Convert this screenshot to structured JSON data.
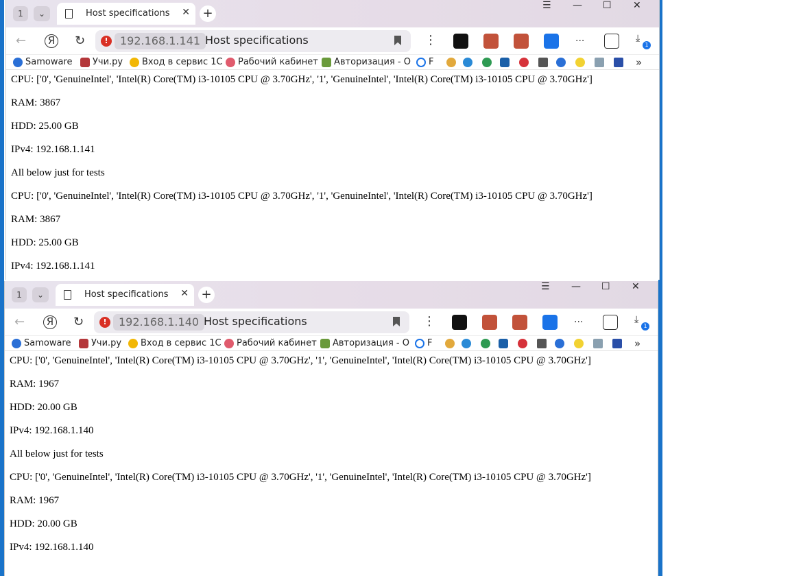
{
  "windows": [
    {
      "tab_count": "1",
      "tab_title": "Host specifications",
      "address_ip": "192.168.1.141",
      "address_title": "Host specifications",
      "ext_more": "...",
      "download_badge": "1",
      "bookmarks": [
        "Samoware",
        "Учи.ру",
        "Вход в сервис 1С",
        "Рабочий кабинет",
        "Авторизация - О",
        "F"
      ],
      "lines": [
        "CPU: ['0', 'GenuineIntel', 'Intel(R) Core(TM) i3-10105 CPU @ 3.70GHz', '1', 'GenuineIntel', 'Intel(R) Core(TM) i3-10105 CPU @ 3.70GHz']",
        "RAM: 3867",
        "HDD: 25.00 GB",
        "IPv4: 192.168.1.141",
        "All below just for tests",
        "CPU: ['0', 'GenuineIntel', 'Intel(R) Core(TM) i3-10105 CPU @ 3.70GHz', '1', 'GenuineIntel', 'Intel(R) Core(TM) i3-10105 CPU @ 3.70GHz']",
        "RAM: 3867",
        "HDD: 25.00 GB",
        "IPv4: 192.168.1.141"
      ]
    },
    {
      "tab_count": "1",
      "tab_title": "Host specifications",
      "address_ip": "192.168.1.140",
      "address_title": "Host specifications",
      "ext_more": "...",
      "download_badge": "1",
      "bookmarks": [
        "Samoware",
        "Учи.ру",
        "Вход в сервис 1С",
        "Рабочий кабинет",
        "Авторизация - О",
        "F"
      ],
      "lines": [
        "CPU: ['0', 'GenuineIntel', 'Intel(R) Core(TM) i3-10105 CPU @ 3.70GHz', '1', 'GenuineIntel', 'Intel(R) Core(TM) i3-10105 CPU @ 3.70GHz']",
        "RAM: 1967",
        "HDD: 20.00 GB",
        "IPv4: 192.168.1.140",
        "All below just for tests",
        "CPU: ['0', 'GenuineIntel', 'Intel(R) Core(TM) i3-10105 CPU @ 3.70GHz', '1', 'GenuineIntel', 'Intel(R) Core(TM) i3-10105 CPU @ 3.70GHz']",
        "RAM: 1967",
        "HDD: 20.00 GB",
        "IPv4: 192.168.1.140"
      ]
    }
  ],
  "colors": {
    "desktop": "#1a73c9",
    "titlebar": "#e7dde8",
    "warning": "#d93025",
    "badge": "#1a73e8"
  }
}
